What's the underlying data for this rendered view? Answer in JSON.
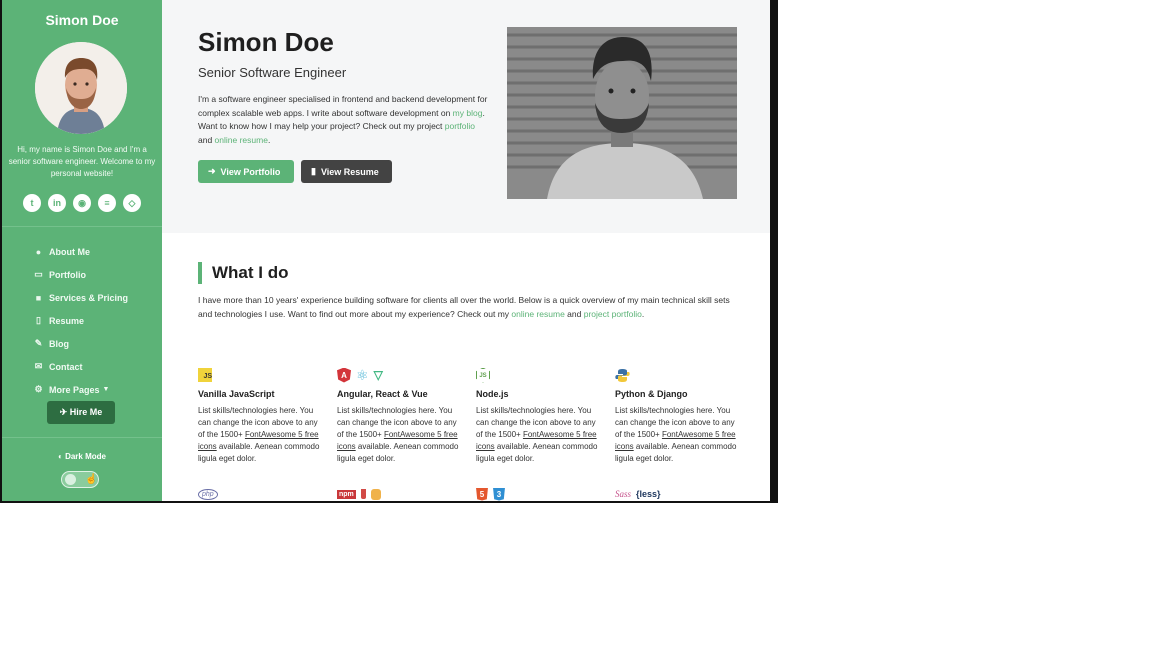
{
  "sidebar": {
    "site_name": "Simon Doe",
    "bio": "Hi, my name is Simon Doe and I'm a senior software engineer. Welcome to my personal website!",
    "socials": [
      {
        "icon": "twitter-icon",
        "glyph": "t"
      },
      {
        "icon": "linkedin-icon",
        "glyph": "in"
      },
      {
        "icon": "github-icon",
        "glyph": "◉"
      },
      {
        "icon": "stack-overflow-icon",
        "glyph": "≡"
      },
      {
        "icon": "codepen-icon",
        "glyph": "◇"
      }
    ],
    "nav": [
      {
        "label": "About Me",
        "icon": "user-icon",
        "glyph": "●"
      },
      {
        "label": "Portfolio",
        "icon": "laptop-code-icon",
        "glyph": "▭"
      },
      {
        "label": "Services & Pricing",
        "icon": "briefcase-icon",
        "glyph": "■"
      },
      {
        "label": "Resume",
        "icon": "file-alt-icon",
        "glyph": "▯"
      },
      {
        "label": "Blog",
        "icon": "blog-icon",
        "glyph": "✎"
      },
      {
        "label": "Contact",
        "icon": "envelope-open-icon",
        "glyph": "✉"
      },
      {
        "label": "More Pages",
        "icon": "cogs-icon",
        "glyph": "⚙"
      }
    ],
    "hire_label": "Hire Me",
    "dark_mode_label": "Dark Mode"
  },
  "hero": {
    "name": "Simon Doe",
    "title": "Senior Software Engineer",
    "intro_1": "I'm a software engineer specialised in frontend and backend development for complex scalable web apps. I write about software development on ",
    "link_blog": "my blog",
    "intro_2": ". Want to know how I may help your project? Check out my project ",
    "link_portfolio": "portfolio",
    "intro_3": " and ",
    "link_resume": "online resume",
    "intro_4": ".",
    "btn_portfolio": "View Portfolio",
    "btn_resume": "View Resume"
  },
  "what_i_do": {
    "title": "What I do",
    "intro_1": "I have more than 10 years' experience building software for clients all over the world. Below is a quick overview of my main technical skill sets and technologies I use. Want to find out more about my experience? Check out my ",
    "link_resume": "online resume",
    "intro_2": " and ",
    "link_portfolio": "project portfolio",
    "intro_3": ".",
    "skills": [
      {
        "name": "Vanilla JavaScript"
      },
      {
        "name": "Angular, React & Vue"
      },
      {
        "name": "Node.js"
      },
      {
        "name": "Python & Django"
      }
    ],
    "desc_1": "List skills/technologies here. You can change the icon above to any of the 1500+ ",
    "desc_link_1": "FontAwesome 5 free icons",
    "desc_2": " available. Aenean commodo ligula eget dolor.",
    "badges": {
      "js": "JS",
      "angular": "A",
      "nodejs": "JS",
      "php": "php",
      "npm": "npm",
      "less": "{less}",
      "sass": "Sass",
      "html5": "5",
      "css3": "3"
    }
  },
  "colors": {
    "accent": "#5cb377",
    "sidebar_bg": "#5cb377",
    "dark_button": "#434343"
  }
}
